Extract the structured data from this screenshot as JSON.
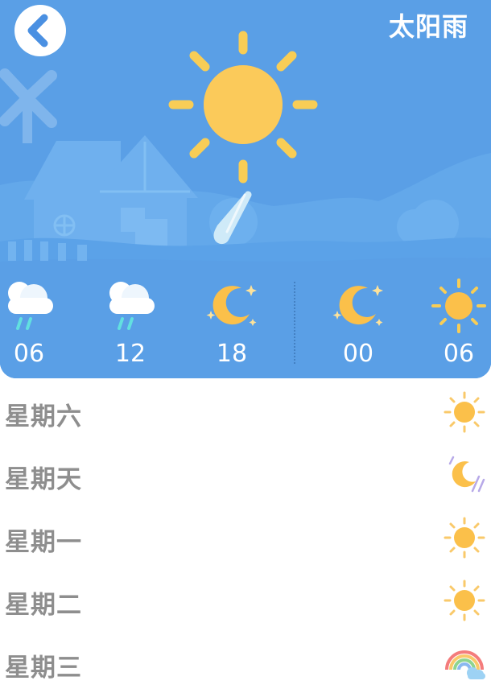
{
  "header": {
    "title": "太阳雨",
    "back_icon": "chevron-left-icon",
    "sky_color": "#5a9fe6",
    "current_icon": "sun-icon",
    "current_extra_icon": "raindrop-icon"
  },
  "hourly": [
    {
      "time": "06",
      "icon": "cloud-rain-icon"
    },
    {
      "time": "12",
      "icon": "cloud-rain-icon"
    },
    {
      "time": "18",
      "icon": "moon-icon"
    },
    {
      "time": "00",
      "icon": "moon-icon"
    },
    {
      "time": "06",
      "icon": "sun-icon"
    }
  ],
  "daily": [
    {
      "day": "星期六",
      "icon": "sun-icon"
    },
    {
      "day": "星期天",
      "icon": "moon-rain-icon"
    },
    {
      "day": "星期一",
      "icon": "sun-icon"
    },
    {
      "day": "星期二",
      "icon": "sun-icon"
    },
    {
      "day": "星期三",
      "icon": "rainbow-icon"
    }
  ]
}
